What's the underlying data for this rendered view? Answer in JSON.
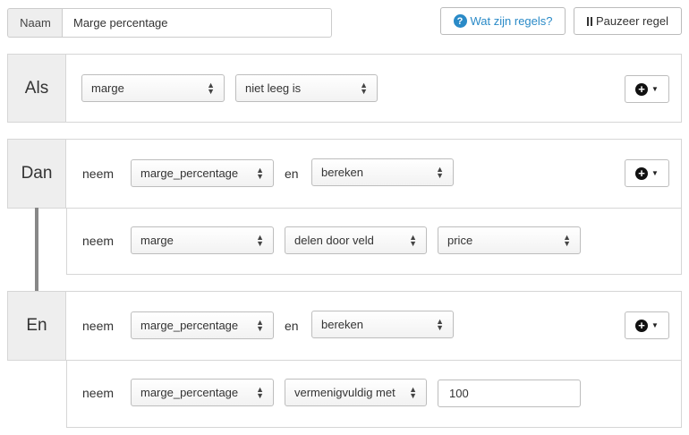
{
  "header": {
    "name_label": "Naam",
    "name_value": "Marge percentage",
    "help_label": "Wat zijn regels?",
    "pause_label": "Pauzeer regel"
  },
  "als": {
    "label": "Als",
    "field": "marge",
    "condition": "niet leeg is"
  },
  "dan": {
    "label": "Dan",
    "row1": {
      "keyword": "neem",
      "field": "marge_percentage",
      "connector": "en",
      "action": "bereken"
    },
    "row2": {
      "keyword": "neem",
      "field": "marge",
      "operation": "delen door veld",
      "operand": "price"
    }
  },
  "en": {
    "label": "En",
    "row1": {
      "keyword": "neem",
      "field": "marge_percentage",
      "connector": "en",
      "action": "bereken"
    },
    "row2": {
      "keyword": "neem",
      "field": "marge_percentage",
      "operation": "vermenigvuldig met",
      "value": "100"
    }
  },
  "icons": {
    "help": "question-circle-icon",
    "pause": "pause-icon",
    "add": "plus-circle-icon",
    "dropdown": "caret-down-icon",
    "select": "up-down-arrows-icon"
  },
  "colors": {
    "link": "#2a8ac7",
    "label_bg": "#eeeeee",
    "border": "#d6d6d6",
    "connector": "#888888"
  }
}
